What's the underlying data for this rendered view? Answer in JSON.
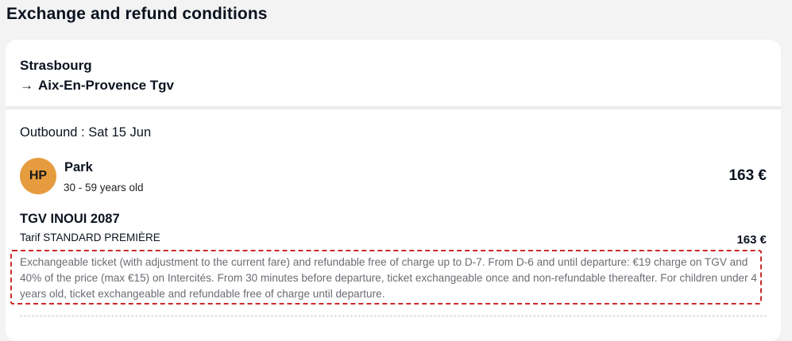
{
  "page": {
    "title": "Exchange and refund conditions"
  },
  "route": {
    "origin": "Strasbourg",
    "arrow": "→",
    "destination": "Aix-En-Provence Tgv"
  },
  "journey": {
    "outbound_label": "Outbound : Sat 15 Jun"
  },
  "passenger": {
    "initials": "HP",
    "name": "Park",
    "age_range": "30 - 59 years old",
    "price": "163 €",
    "avatar_color": "#e69c3e"
  },
  "segment": {
    "train": "TGV INOUI 2087",
    "tarif": "Tarif STANDARD PREMIÈRE",
    "price": "163 €",
    "conditions": "Exchangeable ticket (with adjustment to the current fare) and refundable free of charge up to D-7. From D-6 and until departure: €19 charge on TGV and 40% of the price (max €15) on Intercités. From 30 minutes before departure, ticket exchangeable once and non-refundable thereafter. For children under 4 years old, ticket exchangeable and refundable free of charge until departure.",
    "highlight_color": "#cc2a2a"
  }
}
